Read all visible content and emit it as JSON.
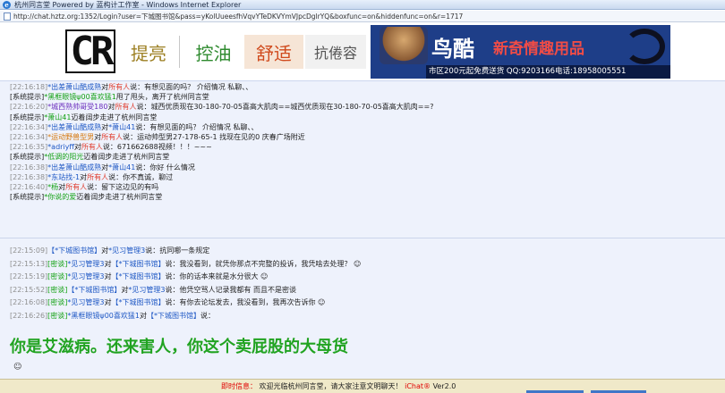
{
  "window": {
    "title": "杭州同言堂 Powered by 蓝构计工作室 - Windows Internet Explorer",
    "url": "http://chat.hztz.org:1352/Login?user=下城图书馆&pass=yKolUueesfhVqvYTeDKVYmVJpcDglrYQ&boxfunc=on&hiddenfunc=on&r=1717"
  },
  "banner": {
    "logo": "CR",
    "words": [
      "提亮",
      "控油",
      "舒适",
      "抗倦容"
    ],
    "right_ad": {
      "brand": "鸟酷",
      "slogan": "新奇情趣用品",
      "strip": "市区200元起免费送货 QQ:9203166电话:18958005551"
    }
  },
  "chat_lines": [
    {
      "ts": "[22:16:18]",
      "user": "*出差萧山酷成熟",
      "mid": "对",
      "target": "所有人",
      "text": "说：有想见面的吗？  介绍情况  私聊、、",
      "user_color": "u-blue",
      "target_color": "u-red"
    },
    {
      "ts": "",
      "prefix": "[系统提示]",
      "user": "*黑框眼镜ψ00喜欢猛1",
      "text": "甩了甩头，离开了杭州同言堂",
      "user_color": "u-green"
    },
    {
      "ts": "[22:16:20]",
      "user": "*城西熟帅哥受180",
      "mid": "对",
      "target": "所有人",
      "text": "说：城西优质现在30-180-70-05喜高大肌肉==城西优质现在30-180-70-05喜高大肌肉==?",
      "user_color": "u-purple",
      "target_color": "u-red"
    },
    {
      "ts": "",
      "prefix": "[系统提示]",
      "user": "*萧山41",
      "text": "迈着阔步走进了杭州同言堂",
      "user_color": "u-green"
    },
    {
      "ts": "[22:16:34]",
      "user": "*出差萧山酷成熟",
      "mid": "对",
      "target": "*萧山41",
      "text": "说：有想见面的吗？  介绍情况  私聊、、",
      "user_color": "u-blue",
      "target_color": "u-blue"
    },
    {
      "ts": "[22:16:34]",
      "user": "*运动野兽型男",
      "mid": "对",
      "target": "所有人",
      "text": "说：运动帅型男27-178-65-1 找现在见的0 庆春广场附近",
      "user_color": "u-orange",
      "target_color": "u-red"
    },
    {
      "ts": "[22:16:35]",
      "user": "*adriyff",
      "mid": "对",
      "target": "所有人",
      "text": "说：671662688视频！！！~~~",
      "user_color": "u-blue",
      "target_color": "u-red"
    },
    {
      "ts": "",
      "prefix": "[系统提示]",
      "user": "*低调的阳光",
      "text": "迈着阔步走进了杭州同言堂",
      "user_color": "u-green"
    },
    {
      "ts": "[22:16:38]",
      "user": "*出差萧山酷成熟",
      "mid": "对",
      "target": "*萧山41",
      "text": "说：你好 什么情况",
      "user_color": "u-blue",
      "target_color": "u-blue"
    },
    {
      "ts": "[22:16:38]",
      "user": "*东站找-1",
      "mid": "对",
      "target": "所有人",
      "text": "说：你不真诚，聊过",
      "user_color": "u-blue",
      "target_color": "u-red"
    },
    {
      "ts": "[22:16:40]",
      "user": "*杨",
      "mid": "对",
      "target": "所有人",
      "text": "说：留下这边见的有吗",
      "user_color": "u-green",
      "target_color": "u-red"
    },
    {
      "ts": "",
      "prefix": "[系统提示]",
      "user": "*你说的爱",
      "text": "迈着阔步走进了杭州同言堂",
      "user_color": "u-green"
    }
  ],
  "private_lines": [
    {
      "ts": "[22:15:09]",
      "pre": "",
      "user": "【*下城图书馆】",
      "mid": "对",
      "target": "*见习管理3",
      "text": "说：抗同哪一条规定"
    },
    {
      "ts": "[22:15:13]",
      "pre": "[密谈]",
      "user": "*见习管理3",
      "mid": "对",
      "target": "【*下城图书馆】",
      "text": "说：我没看到，就凭你那点不完整的投诉，我凭啥去处理？ ☺"
    },
    {
      "ts": "[22:15:19]",
      "pre": "[密谈]",
      "user": "*见习管理3",
      "mid": "对",
      "target": "【*下城图书馆】",
      "text": "说：你的话本来就是水分很大 ☺"
    },
    {
      "ts": "[22:15:52]",
      "pre": "[密谈]",
      "user": "【*下城图书馆】",
      "mid": "对",
      "target": "*见习管理3",
      "text": "说：他凭空骂人记录我都有  而且不是密谈"
    },
    {
      "ts": "[22:16:08]",
      "pre": "[密谈]",
      "user": "*见习管理3",
      "mid": "对",
      "target": "【*下城图书馆】",
      "text": "说：有你去论坛发去，我没看到，我再次告诉你 ☺"
    },
    {
      "ts": "[22:16:26]",
      "pre": "[密谈]",
      "user": "*黑框眼镜ψ00喜欢猛1",
      "mid": "对",
      "target": "【*下城图书馆】",
      "text": "说："
    }
  ],
  "big_message": "你是艾滋病。还来害人，你这个卖屁股的大母货",
  "smiley": "☺",
  "status": {
    "label": "即时信息：",
    "message": "欢迎光临杭州同言堂，请大家注意文明聊天！",
    "ver_brand": "iChat®",
    "ver": "Ver2.0"
  }
}
